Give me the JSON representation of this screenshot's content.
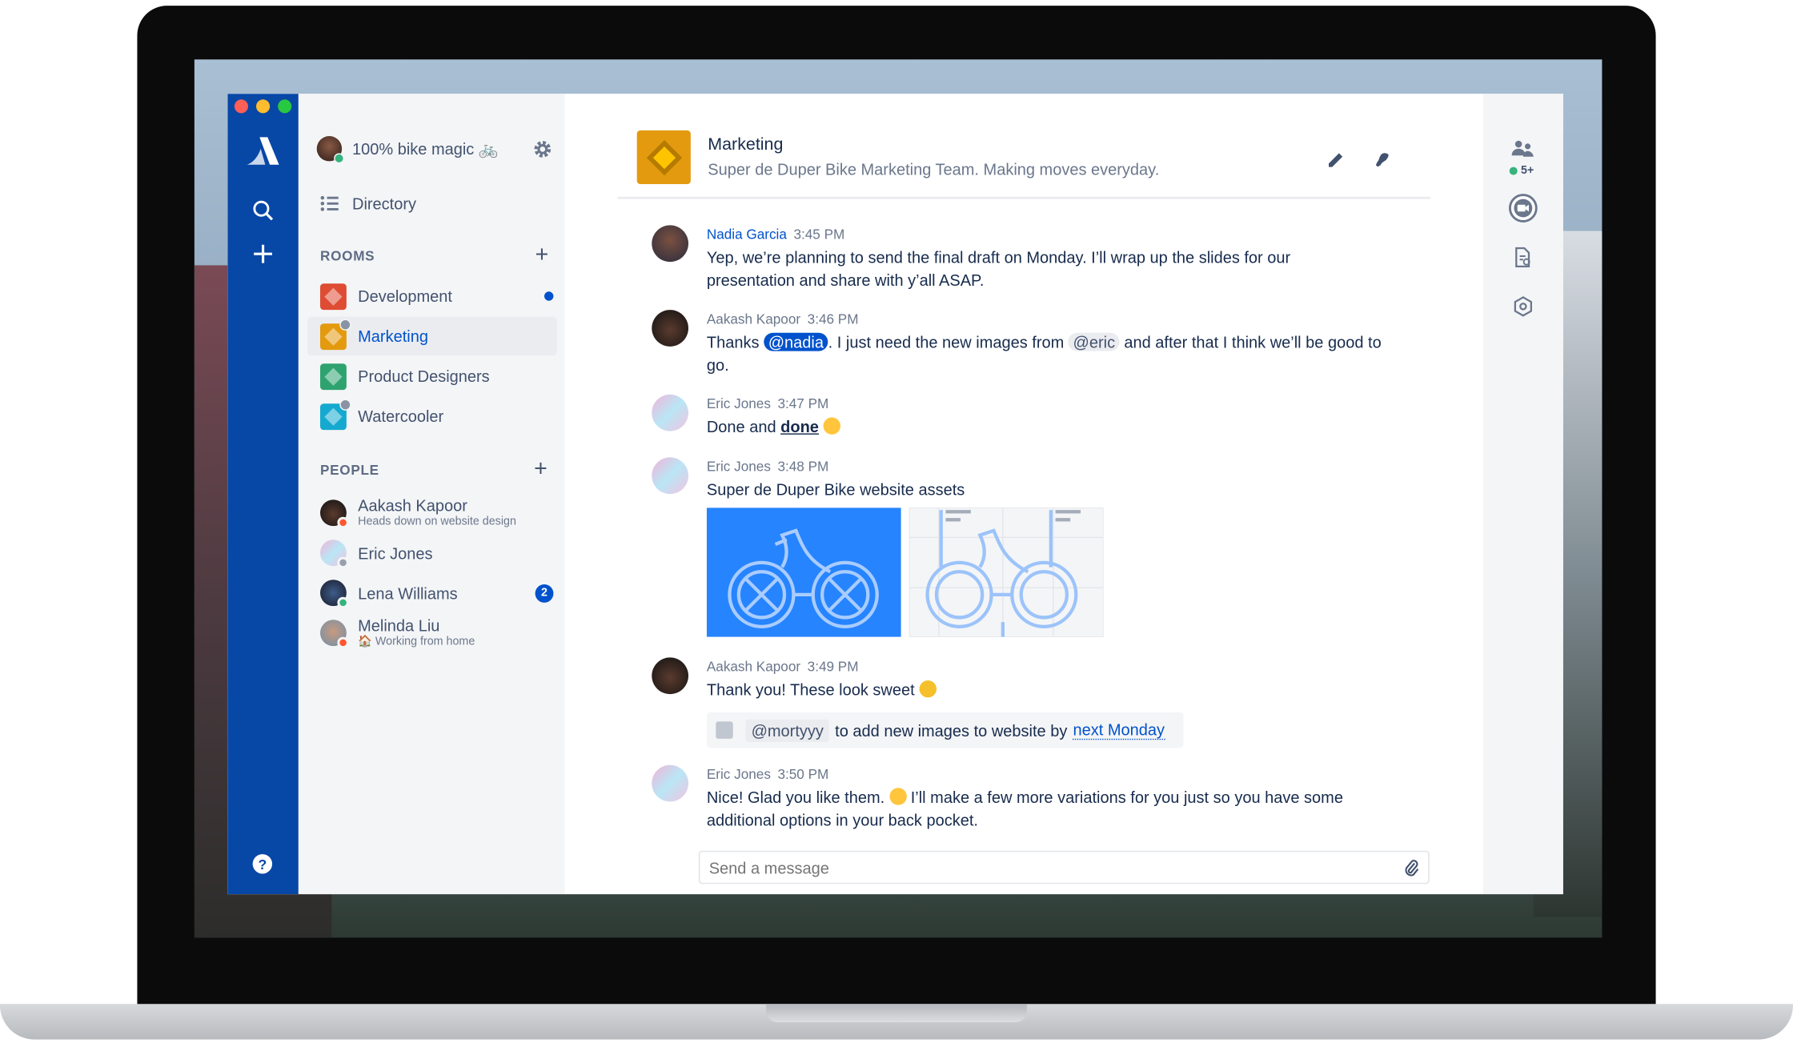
{
  "workspace": {
    "name": "100% bike magic 🚲"
  },
  "nav": {
    "directory": "Directory"
  },
  "rooms": {
    "label": "ROOMS",
    "items": [
      {
        "name": "Development",
        "color": "#DE4C33",
        "unread": true
      },
      {
        "name": "Marketing",
        "color": "#E39A0E",
        "selected": true,
        "private": true
      },
      {
        "name": "Product Designers",
        "color": "#2EA36F"
      },
      {
        "name": "Watercooler",
        "color": "#15A9CF",
        "private": true
      }
    ]
  },
  "people": {
    "label": "PEOPLE",
    "items": [
      {
        "name": "Aakash Kapoor",
        "status": "Heads down on website design",
        "presence": "busy"
      },
      {
        "name": "Eric Jones",
        "status": "",
        "presence": "away"
      },
      {
        "name": "Lena Williams",
        "status": "",
        "presence": "online",
        "badge": "2"
      },
      {
        "name": "Melinda Liu",
        "status": "🏠 Working from home",
        "presence": "busy"
      }
    ]
  },
  "room": {
    "title": "Marketing",
    "topic": "Super de Duper Bike Marketing Team. Making moves everyday."
  },
  "members": {
    "count": "5+"
  },
  "messages": [
    {
      "author": "Nadia Garcia",
      "time": "3:45 PM",
      "text": "Yep, we’re planning to send the final draft on Monday. I’ll wrap up the slides for our presentation and share with y’all ASAP."
    },
    {
      "author": "Aakash Kapoor",
      "time": "3:46 PM",
      "t1": "Thanks ",
      "m1": "@nadia",
      "t2": ". I just need the new images from ",
      "m2": "@eric",
      "t3": " and after that I think we’ll be good to go."
    },
    {
      "author": "Eric Jones",
      "time": "3:47 PM",
      "t1": "Done and ",
      "bold": "done"
    },
    {
      "author": "Eric Jones",
      "time": "3:48 PM",
      "text": "Super de Duper Bike website assets"
    },
    {
      "author": "Aakash Kapoor",
      "time": "3:49 PM",
      "text": "Thank you! These look sweet",
      "task": {
        "mention": "@mortyyy",
        "text": "to add new images to website by",
        "date": "next Monday",
        "done": false
      }
    },
    {
      "author": "Eric Jones",
      "time": "3:50 PM",
      "t1": "Nice! Glad you like them. ",
      "t2": " I’ll make a few more variations for you just so you have some additional options in your back pocket."
    }
  ],
  "composer": {
    "placeholder": "Send a message"
  },
  "colors": {
    "rail": "#0747A6",
    "accent": "#0052CC",
    "sidebar": "#F4F5F7"
  }
}
